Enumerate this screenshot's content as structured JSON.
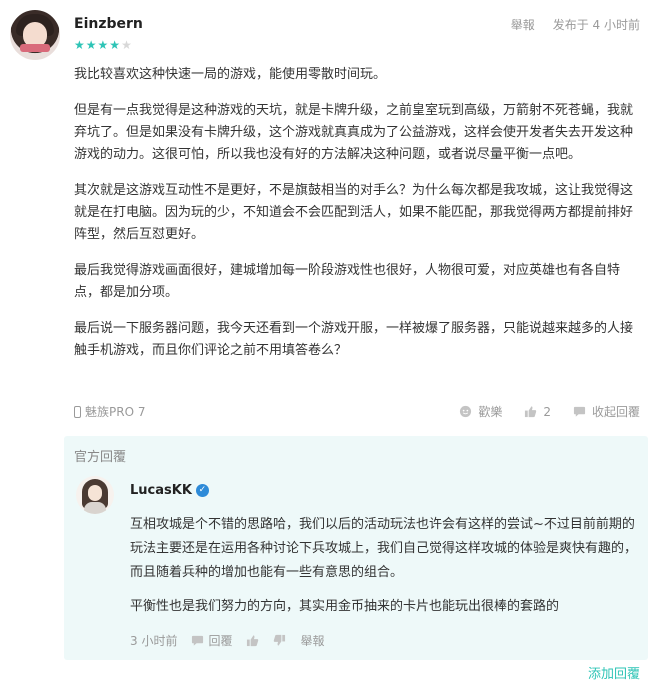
{
  "review": {
    "username": "Einzbern",
    "rating": 4,
    "rating_max": 5,
    "report_label": "舉報",
    "published": "发布于 4 小时前",
    "paragraphs": [
      "我比较喜欢这种快速一局的游戏，能使用零散时间玩。",
      "但是有一点我觉得是这种游戏的天坑，就是卡牌升级，之前皇室玩到高级，万箭射不死苍蝇，我就弃坑了。但是如果没有卡牌升级，这个游戏就真真成为了公益游戏，这样会使开发者失去开发这种游戏的动力。这很可怕，所以我也没有好的方法解决这种问题，或者说尽量平衡一点吧。",
      "其次就是这游戏互动性不是更好，不是旗鼓相当的对手么？为什么每次都是我攻城，这让我觉得这就是在打电脑。因为玩的少，不知道会不会匹配到活人，如果不能匹配，那我觉得两方都提前排好阵型，然后互怼更好。",
      "最后我觉得游戏画面很好，建城增加每一阶段游戏性也很好，人物很可爱，对应英雄也有各自特点，都是加分项。",
      "最后说一下服务器问题，我今天还看到一个游戏开服，一样被爆了服务器，只能说越来越多的人接触手机游戏，而且你们评论之前不用填答卷么？"
    ],
    "device": "魅族PRO 7",
    "happy_label": "歡樂",
    "like_count": "2",
    "collapse_label": "收起回覆"
  },
  "official_reply": {
    "header": "官方回覆",
    "dev_name": "LucasKK",
    "paragraphs": [
      "互相攻城是个不错的思路哈，我们以后的活动玩法也许会有这样的尝试~不过目前前期的玩法主要还是在运用各种讨论下兵攻城上，我们自己觉得这样攻城的体验是爽快有趣的，而且随着兵种的增加也能有一些有意思的组合。",
      "平衡性也是我们努力的方向，其实用金币抽来的卡片也能玩出很棒的套路的"
    ],
    "time": "3 小时前",
    "reply_label": "回覆",
    "report_label": "舉報"
  },
  "add_reply_label": "添加回覆",
  "colors": {
    "accent": "#2ec4b6",
    "reply_bg": "#eef9f9",
    "muted": "#9a9a9a"
  },
  "icons": [
    "phone-icon",
    "smile-icon",
    "thumb-up-icon",
    "thumb-down-icon",
    "reply-icon",
    "verified-icon"
  ]
}
